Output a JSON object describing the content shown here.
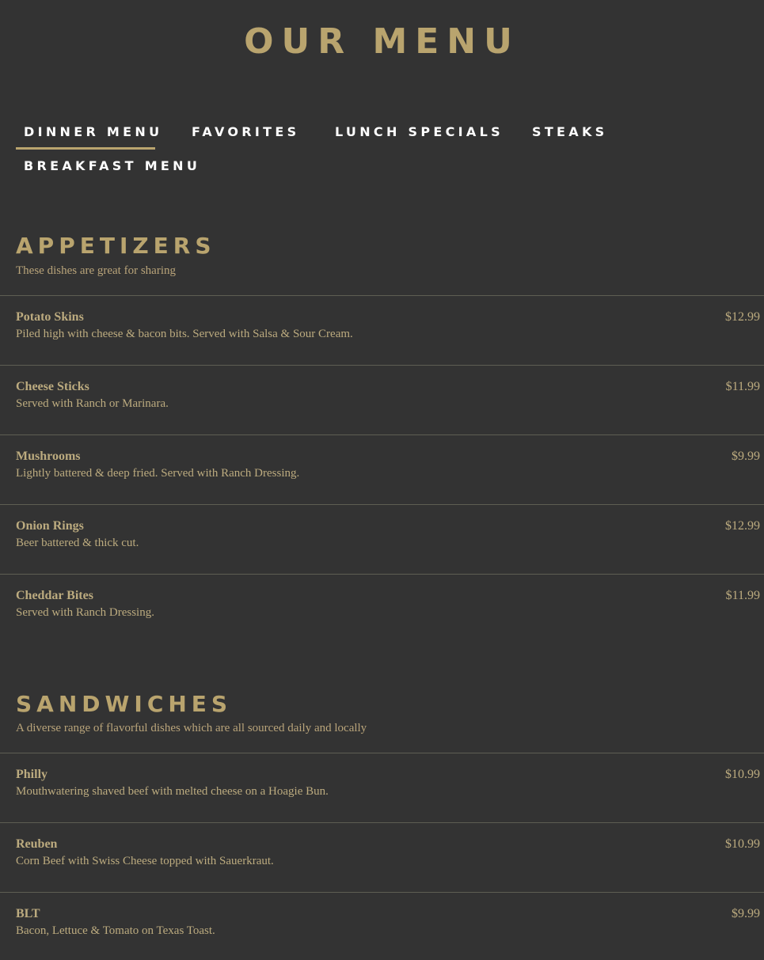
{
  "page": {
    "title": "OUR MENU"
  },
  "tabs": [
    {
      "label": "DINNER MENU",
      "active": true
    },
    {
      "label": "FAVORITES",
      "active": false
    },
    {
      "label": "LUNCH SPECIALS",
      "active": false
    },
    {
      "label": "STEAKS",
      "active": false
    },
    {
      "label": "BREAKFAST MENU",
      "active": false
    }
  ],
  "sections": [
    {
      "title": "APPETIZERS",
      "subtitle": "These dishes are great for sharing",
      "items": [
        {
          "name": "Potato Skins",
          "desc": "Piled high with cheese & bacon bits. Served with Salsa & Sour Cream.",
          "price": "$12.99"
        },
        {
          "name": "Cheese Sticks",
          "desc": "Served with Ranch or Marinara.",
          "price": "$11.99"
        },
        {
          "name": "Mushrooms",
          "desc": "Lightly battered & deep fried. Served with Ranch Dressing.",
          "price": "$9.99"
        },
        {
          "name": "Onion Rings",
          "desc": "Beer battered & thick cut.",
          "price": "$12.99"
        },
        {
          "name": "Cheddar Bites",
          "desc": "Served with Ranch Dressing.",
          "price": "$11.99"
        }
      ]
    },
    {
      "title": "SANDWICHES",
      "subtitle": "A diverse range of flavorful dishes which are all sourced daily and locally",
      "items": [
        {
          "name": "Philly",
          "desc": "Mouthwatering shaved beef with melted cheese on a Hoagie Bun.",
          "price": "$10.99"
        },
        {
          "name": "Reuben",
          "desc": "Corn Beef with Swiss Cheese topped with Sauerkraut.",
          "price": "$10.99"
        },
        {
          "name": "BLT",
          "desc": "Bacon, Lettuce & Tomato on Texas Toast.",
          "price": "$9.99"
        }
      ]
    }
  ],
  "colors": {
    "background": "#333333",
    "accent": "#b9a46e",
    "tab_text": "#ffffff",
    "body_text": "#bcab7f",
    "divider": "#5e5e53"
  }
}
